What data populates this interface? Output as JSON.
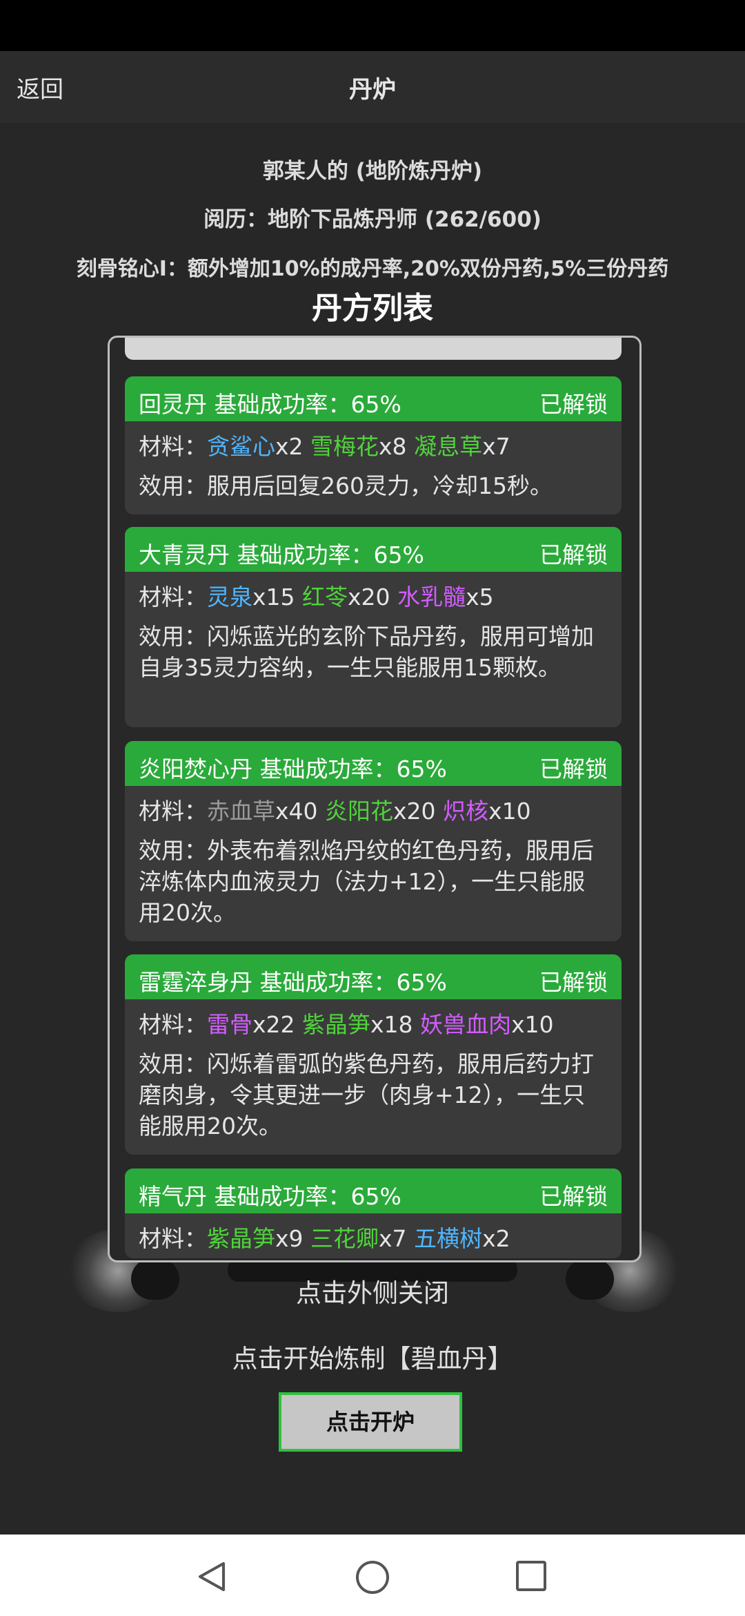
{
  "header": {
    "back_label": "返回",
    "title": "丹炉"
  },
  "info": {
    "owner": "郭某人的 (地阶炼丹炉)",
    "experience": "阅历：地阶下品炼丹师 (262/600)",
    "skill": "刻骨铭心I：额外增加10%的成丹率,20%双份丹药,5%三份丹药"
  },
  "list_title": "丹方列表",
  "recipes": [
    {
      "title": "回灵丹 基础成功率：65%",
      "status": "已解锁",
      "materials_label": "材料：",
      "materials": [
        {
          "name": "贪鲨心",
          "qty": "x2",
          "color": "#4fb6ff"
        },
        {
          "name": "雪梅花",
          "qty": "x8",
          "color": "#4fd43a"
        },
        {
          "name": "凝息草",
          "qty": "x7",
          "color": "#4fd43a"
        }
      ],
      "effect": "效用：服用后回复260灵力，冷却15秒。"
    },
    {
      "title": "大青灵丹 基础成功率：65%",
      "status": "已解锁",
      "materials_label": "材料：",
      "materials": [
        {
          "name": "灵泉",
          "qty": "x15",
          "color": "#4fb6ff"
        },
        {
          "name": "红苓",
          "qty": "x20",
          "color": "#4fd43a"
        },
        {
          "name": "水乳髓",
          "qty": "x5",
          "color": "#d25cff"
        }
      ],
      "effect": "效用：闪烁蓝光的玄阶下品丹药，服用可增加自身35灵力容纳，一生只能服用15颗枚。"
    },
    {
      "title": "炎阳焚心丹 基础成功率：65%",
      "status": "已解锁",
      "materials_label": "材料：",
      "materials": [
        {
          "name": "赤血草",
          "qty": "x40",
          "color": "#9a9a9a"
        },
        {
          "name": "炎阳花",
          "qty": "x20",
          "color": "#4fd43a"
        },
        {
          "name": "炽核",
          "qty": "x10",
          "color": "#d25cff"
        }
      ],
      "effect": "效用：外表布着烈焰丹纹的红色丹药，服用后淬炼体内血液灵力（法力+12），一生只能服用20次。"
    },
    {
      "title": "雷霆淬身丹 基础成功率：65%",
      "status": "已解锁",
      "materials_label": "材料：",
      "materials": [
        {
          "name": "雷骨",
          "qty": "x22",
          "color": "#d25cff"
        },
        {
          "name": "紫晶笋",
          "qty": "x18",
          "color": "#4fd43a"
        },
        {
          "name": "妖兽血肉",
          "qty": "x10",
          "color": "#d25cff"
        }
      ],
      "effect": "效用：闪烁着雷弧的紫色丹药，服用后药力打磨肉身，令其更进一步（肉身+12），一生只能服用20次。"
    },
    {
      "title": "精气丹 基础成功率：65%",
      "status": "已解锁",
      "materials_label": "材料：",
      "materials": [
        {
          "name": "紫晶笋",
          "qty": "x9",
          "color": "#4fd43a"
        },
        {
          "name": "三花卿",
          "qty": "x7",
          "color": "#4fd43a"
        },
        {
          "name": "五横树",
          "qty": "x2",
          "color": "#4fb6ff"
        }
      ],
      "effect": ""
    }
  ],
  "close_hint": "点击外侧关闭",
  "start_hint": "点击开始炼制【碧血丹】",
  "open_button_label": "点击开炉",
  "nav": {
    "back_icon": "triangle-back-icon",
    "home_icon": "circle-home-icon",
    "recents_icon": "square-recents-icon"
  },
  "colors": {
    "header_green": "#2aaa3a",
    "button_border": "#2ec23e",
    "blue": "#4fb6ff",
    "green": "#4fd43a",
    "purple": "#d25cff",
    "gray": "#9a9a9a"
  }
}
